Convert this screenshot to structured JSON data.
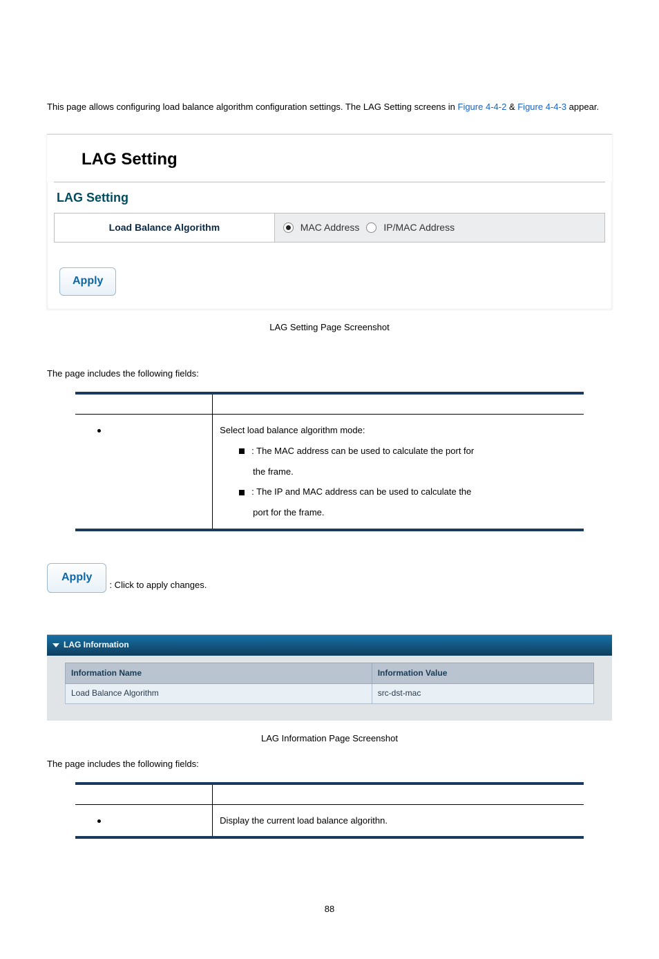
{
  "intro": {
    "prefix": "This page allows configuring load balance algorithm configuration settings. The LAG Setting screens in ",
    "link1": "Figure 4-4-2",
    "amp": " & ",
    "link2": "Figure 4-4-3",
    "suffix": " appear."
  },
  "shot1": {
    "header": "LAG Setting",
    "legend": "LAG Setting",
    "row_label": "Load Balance Algorithm",
    "radio1": "MAC Address",
    "radio2": "IP/MAC Address",
    "apply": "Apply"
  },
  "caption1": "LAG Setting Page Screenshot",
  "fields_intro": "The page includes the following fields:",
  "table1": {
    "desc_line1": "Select load balance algorithm mode:",
    "opt1_suffix": ": The MAC address can be used to calculate the port for",
    "opt1_line2": "the frame.",
    "opt2_suffix": ": The IP and MAC address can be used to calculate the",
    "opt2_line2": "port for the frame."
  },
  "buttons": {
    "apply_label": "Apply",
    "apply_desc": ": Click to apply changes."
  },
  "shot2": {
    "bar_title": "LAG Information",
    "th1": "Information Name",
    "th2": "Information Value",
    "td1": "Load Balance Algorithm",
    "td2": "src-dst-mac"
  },
  "caption2": "LAG Information Page Screenshot",
  "table2": {
    "desc": "Display the current load balance algorithn."
  },
  "page_number": "88"
}
